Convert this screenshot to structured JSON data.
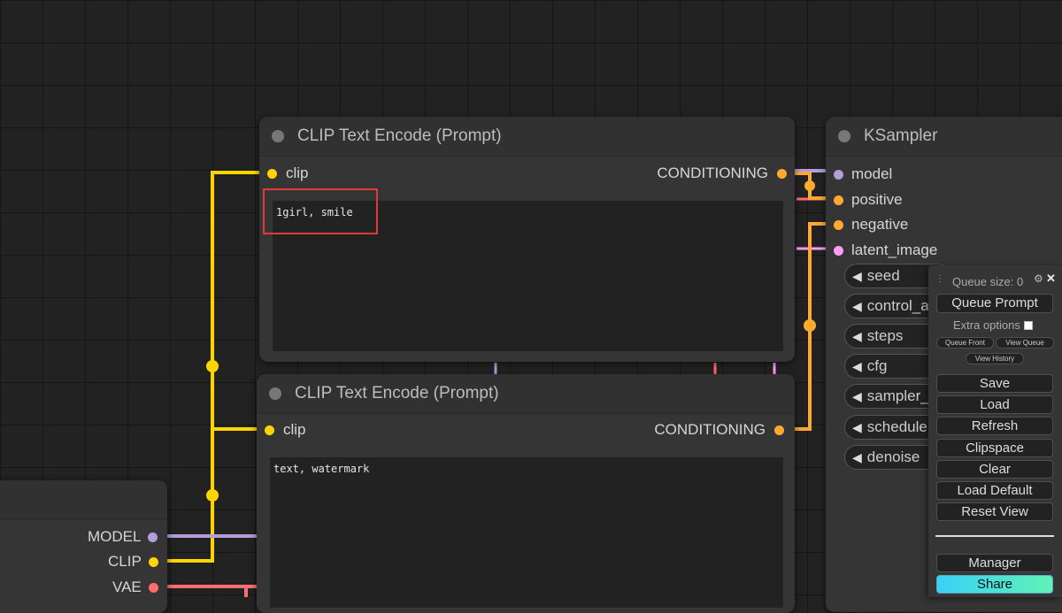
{
  "nodes": {
    "clip_pos": {
      "title": "CLIP Text Encode (Prompt)",
      "input_label": "clip",
      "output_label": "CONDITIONING",
      "text": "1girl, smile"
    },
    "clip_neg": {
      "title": "CLIP Text Encode (Prompt)",
      "input_label": "clip",
      "output_label": "CONDITIONING",
      "text": "text, watermark"
    },
    "ksampler": {
      "title": "KSampler",
      "inputs": [
        "model",
        "positive",
        "negative",
        "latent_image"
      ],
      "widgets": [
        "seed",
        "control_a",
        "steps",
        "cfg",
        "sampler_",
        "schedule",
        "denoise"
      ]
    },
    "checkpoint": {
      "outputs": [
        "MODEL",
        "CLIP",
        "VAE"
      ]
    }
  },
  "menu": {
    "queue_size": "Queue size: 0",
    "queue_prompt": "Queue Prompt",
    "extra_options": "Extra options",
    "queue_front": "Queue Front",
    "view_queue": "View Queue",
    "view_history": "View History",
    "save": "Save",
    "load": "Load",
    "refresh": "Refresh",
    "clipspace": "Clipspace",
    "clear": "Clear",
    "load_default": "Load Default",
    "reset_view": "Reset View",
    "manager": "Manager",
    "share": "Share"
  },
  "colors": {
    "clip_wire": "#ffd500",
    "conditioning_wire": "#ffa931",
    "model_wire": "#b39ddb",
    "latent_wire": "#ff9cf9",
    "vae_wire": "#ff6e6e",
    "highlight": "#e53935"
  }
}
